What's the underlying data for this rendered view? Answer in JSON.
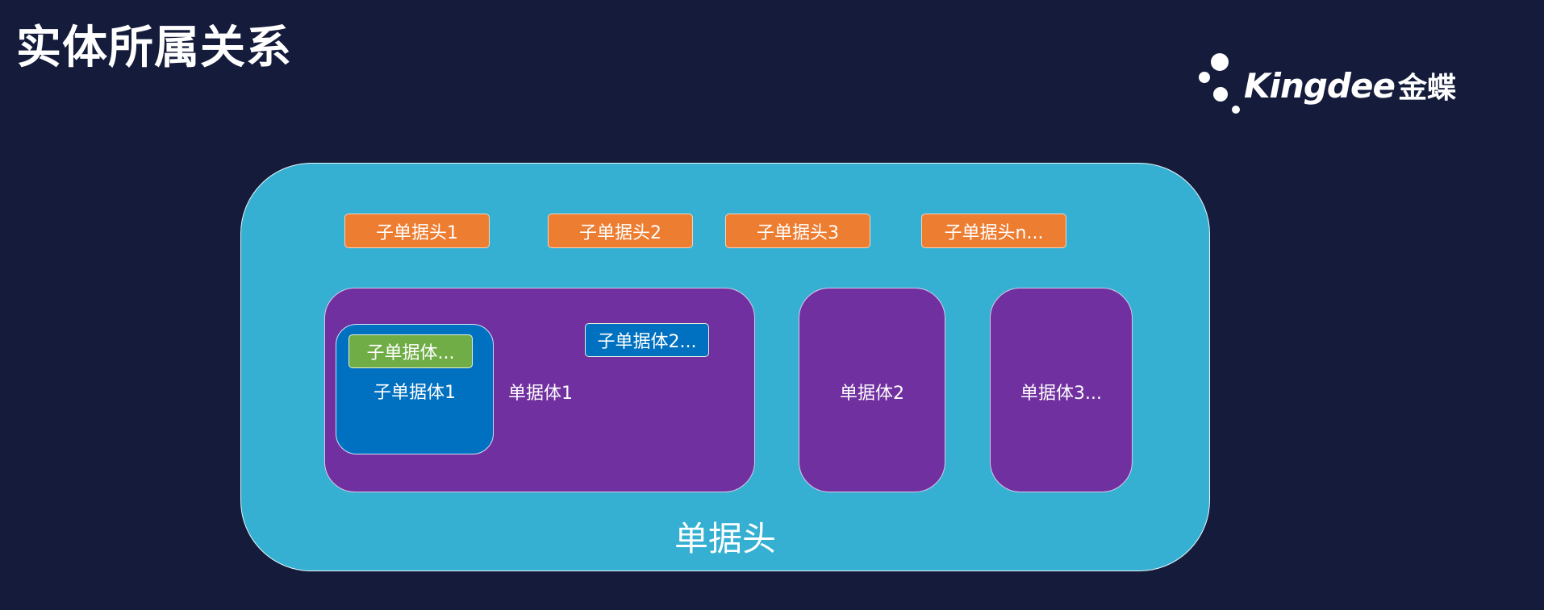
{
  "title": "实体所属关系",
  "logo": {
    "text": "Kingdee",
    "cn": "金蝶"
  },
  "outer": {
    "label": "单据头",
    "color": "#36b0d2"
  },
  "sub_heads": [
    "子单据头1",
    "子单据头2",
    "子单据头3",
    "子单据头n..."
  ],
  "bodies": {
    "body1": {
      "label": "单据体1",
      "sub_body1": {
        "label": "子单据体1",
        "tag": "子单据体..."
      },
      "sub_body2": "子单据体2..."
    },
    "body2": "单据体2",
    "body3": "单据体3..."
  },
  "colors": {
    "background": "#151c3b",
    "sub_head": "#ed7d31",
    "body": "#7030a0",
    "sub_body": "#0070c0",
    "tag": "#70ad47"
  }
}
